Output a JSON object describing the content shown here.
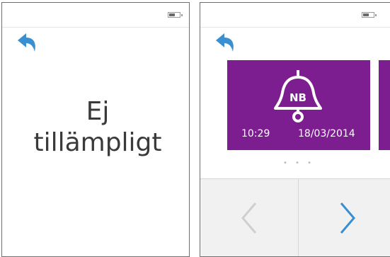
{
  "colors": {
    "accent": "#3a8fd0",
    "card": "#7d1e90",
    "disabled": "#cfcfcf",
    "panel": "#f1f1f1"
  },
  "left_screen": {
    "status_bar": {
      "battery_icon": "battery-icon"
    },
    "back_icon": "back-arrow-icon",
    "message": "Ej\ntillämpligt"
  },
  "right_screen": {
    "status_bar": {
      "battery_icon": "battery-icon"
    },
    "back_icon": "back-arrow-icon",
    "card": {
      "icon": "bell-icon",
      "badge": "NB",
      "time": "10:29",
      "date": "18/03/2014"
    },
    "page_dots": "• • •",
    "nav": {
      "prev_icon": "chevron-left-icon",
      "next_icon": "chevron-right-icon"
    }
  }
}
